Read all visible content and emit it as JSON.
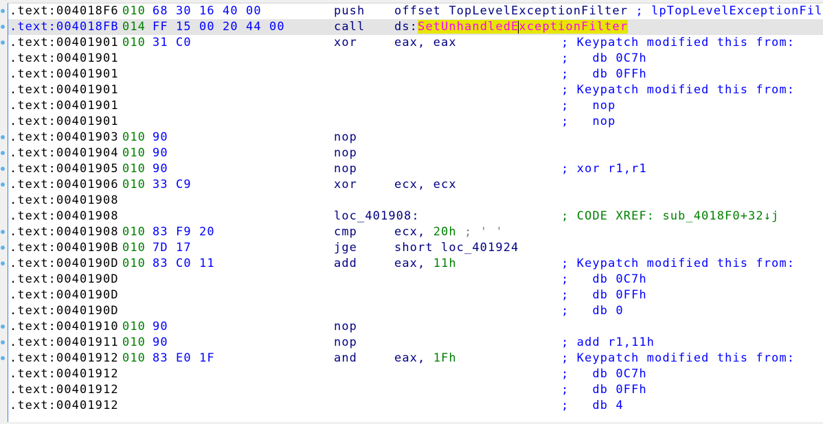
{
  "colors": {
    "address": "#000000",
    "selected_address": "#0000ff",
    "stack": "#008000",
    "bytes": "#0000ff",
    "mnemonic": "#000080",
    "immediate": "#008000",
    "comment": "#0000ff",
    "xref": "#008000",
    "highlight_bg": "#e6e600",
    "highlight_fg": "#ff00ff"
  },
  "rows": [
    {
      "addr": ".text:004018F6",
      "stack": "010",
      "bytes": "68 30 16 40 00",
      "mnem": "push",
      "ops": [
        {
          "t": "offset TopLevelExceptionFilter ",
          "c": "navy"
        },
        {
          "t": "; lpTopLevelExceptionFilter",
          "c": "blue"
        }
      ],
      "comment": "",
      "dot": true
    },
    {
      "addr": ".text:004018FB",
      "stack": "014",
      "bytes": "FF 15 00 20 44 00",
      "mnem": "call",
      "ops": [
        {
          "t": "ds:",
          "c": "navy"
        },
        {
          "t": "SetUnhandledE",
          "c": "hl"
        },
        {
          "t": "xceptionFilter",
          "c": "hl",
          "cursor": true
        }
      ],
      "comment": "",
      "dot": true,
      "selected": true
    },
    {
      "addr": ".text:00401901",
      "stack": "010",
      "bytes": "31 C0",
      "mnem": "xor",
      "ops": [
        {
          "t": "eax, eax",
          "c": "navy"
        }
      ],
      "comment": "; Keypatch modified this from:",
      "dot": true
    },
    {
      "addr": ".text:00401901",
      "comment": ";   db 0C7h"
    },
    {
      "addr": ".text:00401901",
      "comment": ";   db 0FFh"
    },
    {
      "addr": ".text:00401901",
      "comment": "; Keypatch modified this from:"
    },
    {
      "addr": ".text:00401901",
      "comment": ";   nop"
    },
    {
      "addr": ".text:00401901",
      "comment": ";   nop"
    },
    {
      "addr": ".text:00401903",
      "stack": "010",
      "bytes": "90",
      "mnem": "nop",
      "dot": true
    },
    {
      "addr": ".text:00401904",
      "stack": "010",
      "bytes": "90",
      "mnem": "nop",
      "dot": true
    },
    {
      "addr": ".text:00401905",
      "stack": "010",
      "bytes": "90",
      "mnem": "nop",
      "comment": "; xor r1,r1",
      "dot": true
    },
    {
      "addr": ".text:00401906",
      "stack": "010",
      "bytes": "33 C9",
      "mnem": "xor",
      "ops": [
        {
          "t": "ecx, ecx",
          "c": "navy"
        }
      ],
      "dot": true
    },
    {
      "addr": ".text:00401908"
    },
    {
      "addr": ".text:00401908",
      "mnem": "loc_401908:",
      "comment": "; CODE XREF: sub_4018F0+32↓j",
      "comment_color": "green"
    },
    {
      "addr": ".text:00401908",
      "stack": "010",
      "bytes": "83 F9 20",
      "mnem": "cmp",
      "ops": [
        {
          "t": "ecx, ",
          "c": "navy"
        },
        {
          "t": "20h",
          "c": "green"
        },
        {
          "t": " ; ' '",
          "c": "gray"
        }
      ],
      "dot": true
    },
    {
      "addr": ".text:0040190B",
      "stack": "010",
      "bytes": "7D 17",
      "mnem": "jge",
      "ops": [
        {
          "t": "short loc_401924",
          "c": "navy"
        }
      ],
      "dot": true
    },
    {
      "addr": ".text:0040190D",
      "stack": "010",
      "bytes": "83 C0 11",
      "mnem": "add",
      "ops": [
        {
          "t": "eax, ",
          "c": "navy"
        },
        {
          "t": "11h",
          "c": "green"
        }
      ],
      "comment": "; Keypatch modified this from:",
      "dot": true
    },
    {
      "addr": ".text:0040190D",
      "comment": ";   db 0C7h"
    },
    {
      "addr": ".text:0040190D",
      "comment": ";   db 0FFh"
    },
    {
      "addr": ".text:0040190D",
      "comment": ";   db 0"
    },
    {
      "addr": ".text:00401910",
      "stack": "010",
      "bytes": "90",
      "mnem": "nop",
      "dot": true
    },
    {
      "addr": ".text:00401911",
      "stack": "010",
      "bytes": "90",
      "mnem": "nop",
      "comment": "; add r1,11h",
      "dot": true
    },
    {
      "addr": ".text:00401912",
      "stack": "010",
      "bytes": "83 E0 1F",
      "mnem": "and",
      "ops": [
        {
          "t": "eax, ",
          "c": "navy"
        },
        {
          "t": "1Fh",
          "c": "green"
        }
      ],
      "comment": "; Keypatch modified this from:",
      "dot": true
    },
    {
      "addr": ".text:00401912",
      "comment": ";   db 0C7h"
    },
    {
      "addr": ".text:00401912",
      "comment": ";   db 0FFh"
    },
    {
      "addr": ".text:00401912",
      "comment": ";   db 4"
    }
  ]
}
